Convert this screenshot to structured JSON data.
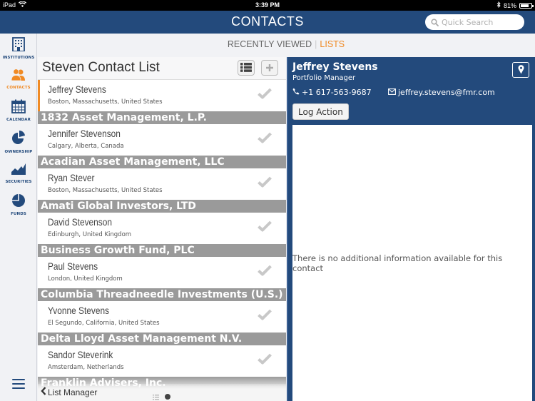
{
  "status_bar": {
    "device": "iPad",
    "time": "3:39 PM",
    "battery_percent": "81%",
    "battery_level": 0.81
  },
  "header": {
    "title": "CONTACTS",
    "search_placeholder": "Quick Search"
  },
  "sidebar": {
    "items": [
      {
        "label": "INSTITUTIONS",
        "icon": "building-icon",
        "active": false
      },
      {
        "label": "CONTACTS",
        "icon": "users-icon",
        "active": true
      },
      {
        "label": "CALENDAR",
        "icon": "calendar-icon",
        "active": false
      },
      {
        "label": "OWNERSHIP",
        "icon": "pie-chart-icon",
        "active": false
      },
      {
        "label": "SECURITIES",
        "icon": "area-chart-icon",
        "active": false
      },
      {
        "label": "FUNDS",
        "icon": "pie-icon",
        "active": false
      }
    ],
    "menu_icon": "hamburger-icon"
  },
  "tabs": [
    {
      "label": "RECENTLY VIEWED",
      "active": false
    },
    {
      "label": "LISTS",
      "active": true
    }
  ],
  "tab_separator": "|",
  "list": {
    "title": "Steven Contact List",
    "entries": [
      {
        "type": "contact",
        "name": "Jeffrey Stevens",
        "location": "Boston, Massachusetts, United States",
        "selected": true
      },
      {
        "type": "group",
        "name": "1832 Asset Management, L.P."
      },
      {
        "type": "contact",
        "name": "Jennifer Stevenson",
        "location": "Calgary, Alberta, Canada"
      },
      {
        "type": "group",
        "name": "Acadian Asset Management, LLC"
      },
      {
        "type": "contact",
        "name": "Ryan Stever",
        "location": "Boston, Massachusetts, United States"
      },
      {
        "type": "group",
        "name": "Amati Global Investors, LTD"
      },
      {
        "type": "contact",
        "name": "David Stevenson",
        "location": "Edinburgh, United Kingdom"
      },
      {
        "type": "group",
        "name": "Business Growth Fund, PLC"
      },
      {
        "type": "contact",
        "name": "Paul Stevens",
        "location": "London, United Kingdom"
      },
      {
        "type": "group",
        "name": "Columbia Threadneedle Investments (U.S.)"
      },
      {
        "type": "contact",
        "name": "Yvonne Stevens",
        "location": "El Segundo, California, United States"
      },
      {
        "type": "group",
        "name": "Delta Lloyd Asset Management N.V."
      },
      {
        "type": "contact",
        "name": "Sandor Steverink",
        "location": "Amsterdam, Netherlands"
      },
      {
        "type": "group",
        "name": "Franklin Advisers, Inc."
      }
    ],
    "footer": {
      "back_label": "List Manager"
    }
  },
  "detail": {
    "name": "Jeffrey Stevens",
    "title": "Portfolio Manager",
    "phone": "+1 617-563-9687",
    "email": "jeffrey.stevens@fmr.com",
    "log_action_label": "Log Action",
    "empty_message": "There is no additional information available for this contact"
  },
  "colors": {
    "brand": "#234a7c",
    "accent": "#f08a24",
    "group_header": "#9a9a9a"
  }
}
